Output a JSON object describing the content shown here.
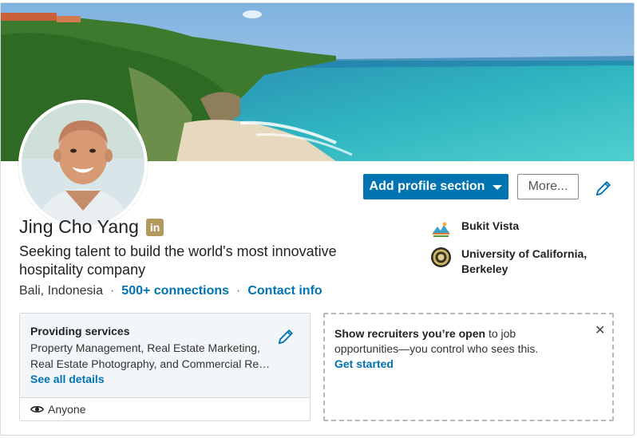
{
  "profile": {
    "name": "Jing Cho Yang",
    "badge": "in",
    "headline": "Seeking talent to build the world's most innovative hospitality company",
    "location": "Bali, Indonesia",
    "separator": "·",
    "connections": "500+ connections",
    "contact": "Contact info"
  },
  "actions": {
    "add_section": "Add profile section",
    "more": "More..."
  },
  "orgs": [
    {
      "name": "Bukit Vista",
      "logo": "bukit-vista-logo"
    },
    {
      "name": "University of California, Berkeley",
      "logo": "uc-berkeley-seal"
    }
  ],
  "services": {
    "title": "Providing services",
    "description": "Property Management, Real Estate Marketing, Real Estate Photography, and Commercial Re…",
    "see_all": "See all details",
    "visibility": "Anyone"
  },
  "recruiters": {
    "bold": "Show recruiters you’re open",
    "rest": " to job opportunities—you control who sees this.",
    "cta": "Get started",
    "close": "✕"
  },
  "colors": {
    "accent": "#0073b1",
    "badge": "#b3995d"
  }
}
